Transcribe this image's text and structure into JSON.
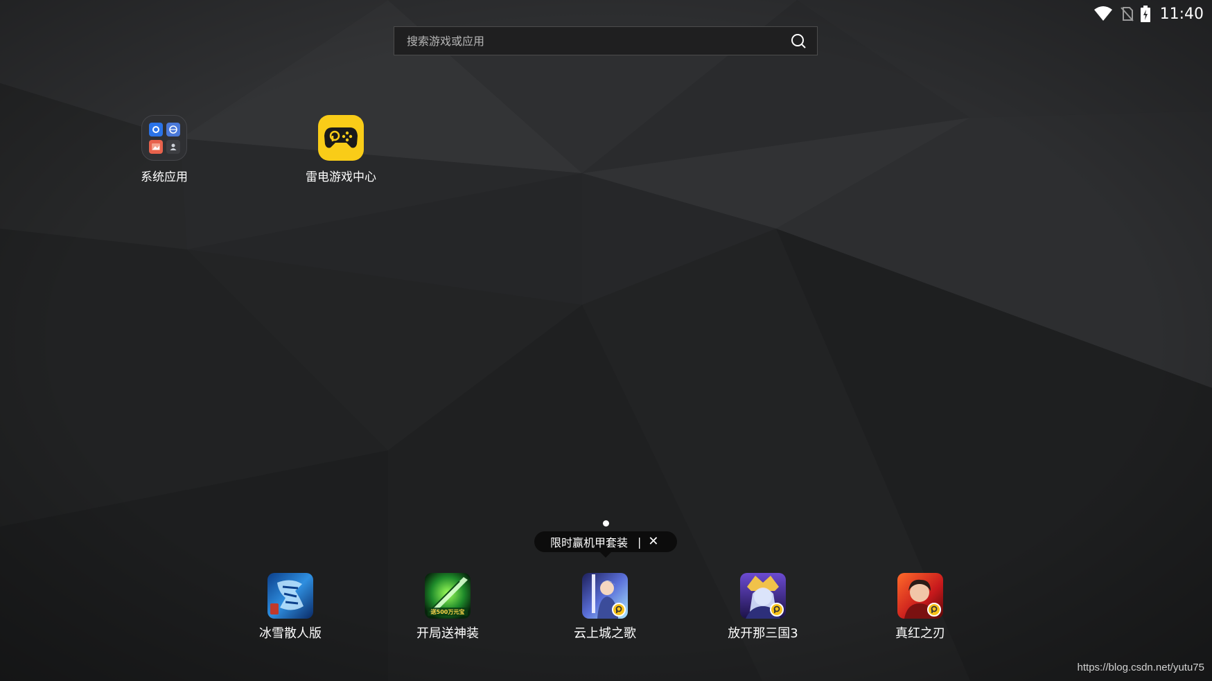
{
  "status_bar": {
    "time": "11:40",
    "icons": [
      "wifi-icon",
      "no-sim-icon",
      "battery-charging-icon"
    ]
  },
  "search": {
    "placeholder": "搜索游戏或应用",
    "icon": "search-icon"
  },
  "desktop_apps": [
    {
      "label": "系统应用",
      "icon": "folder-icon"
    },
    {
      "label": "雷电游戏中心",
      "icon": "gamepad-icon"
    }
  ],
  "page_indicator": {
    "pages": 1,
    "current": 1
  },
  "promo_tooltip": {
    "text": "限时赢机甲套装",
    "separator": "|",
    "close": "✕"
  },
  "dock_apps": [
    {
      "label": "冰雪散人版",
      "icon": "game-icon-bingxue"
    },
    {
      "label": "开局送神装",
      "icon": "game-icon-kaiju",
      "icon_text": "送500万元宝"
    },
    {
      "label": "云上城之歌",
      "icon": "game-icon-yunshang"
    },
    {
      "label": "放开那三国3",
      "icon": "game-icon-sanguo"
    },
    {
      "label": "真红之刃",
      "icon": "game-icon-zhenhong"
    }
  ],
  "watermark": "https://blog.csdn.net/yutu75",
  "colors": {
    "leidian_yellow": "#f9cc18",
    "background": "#262729"
  }
}
